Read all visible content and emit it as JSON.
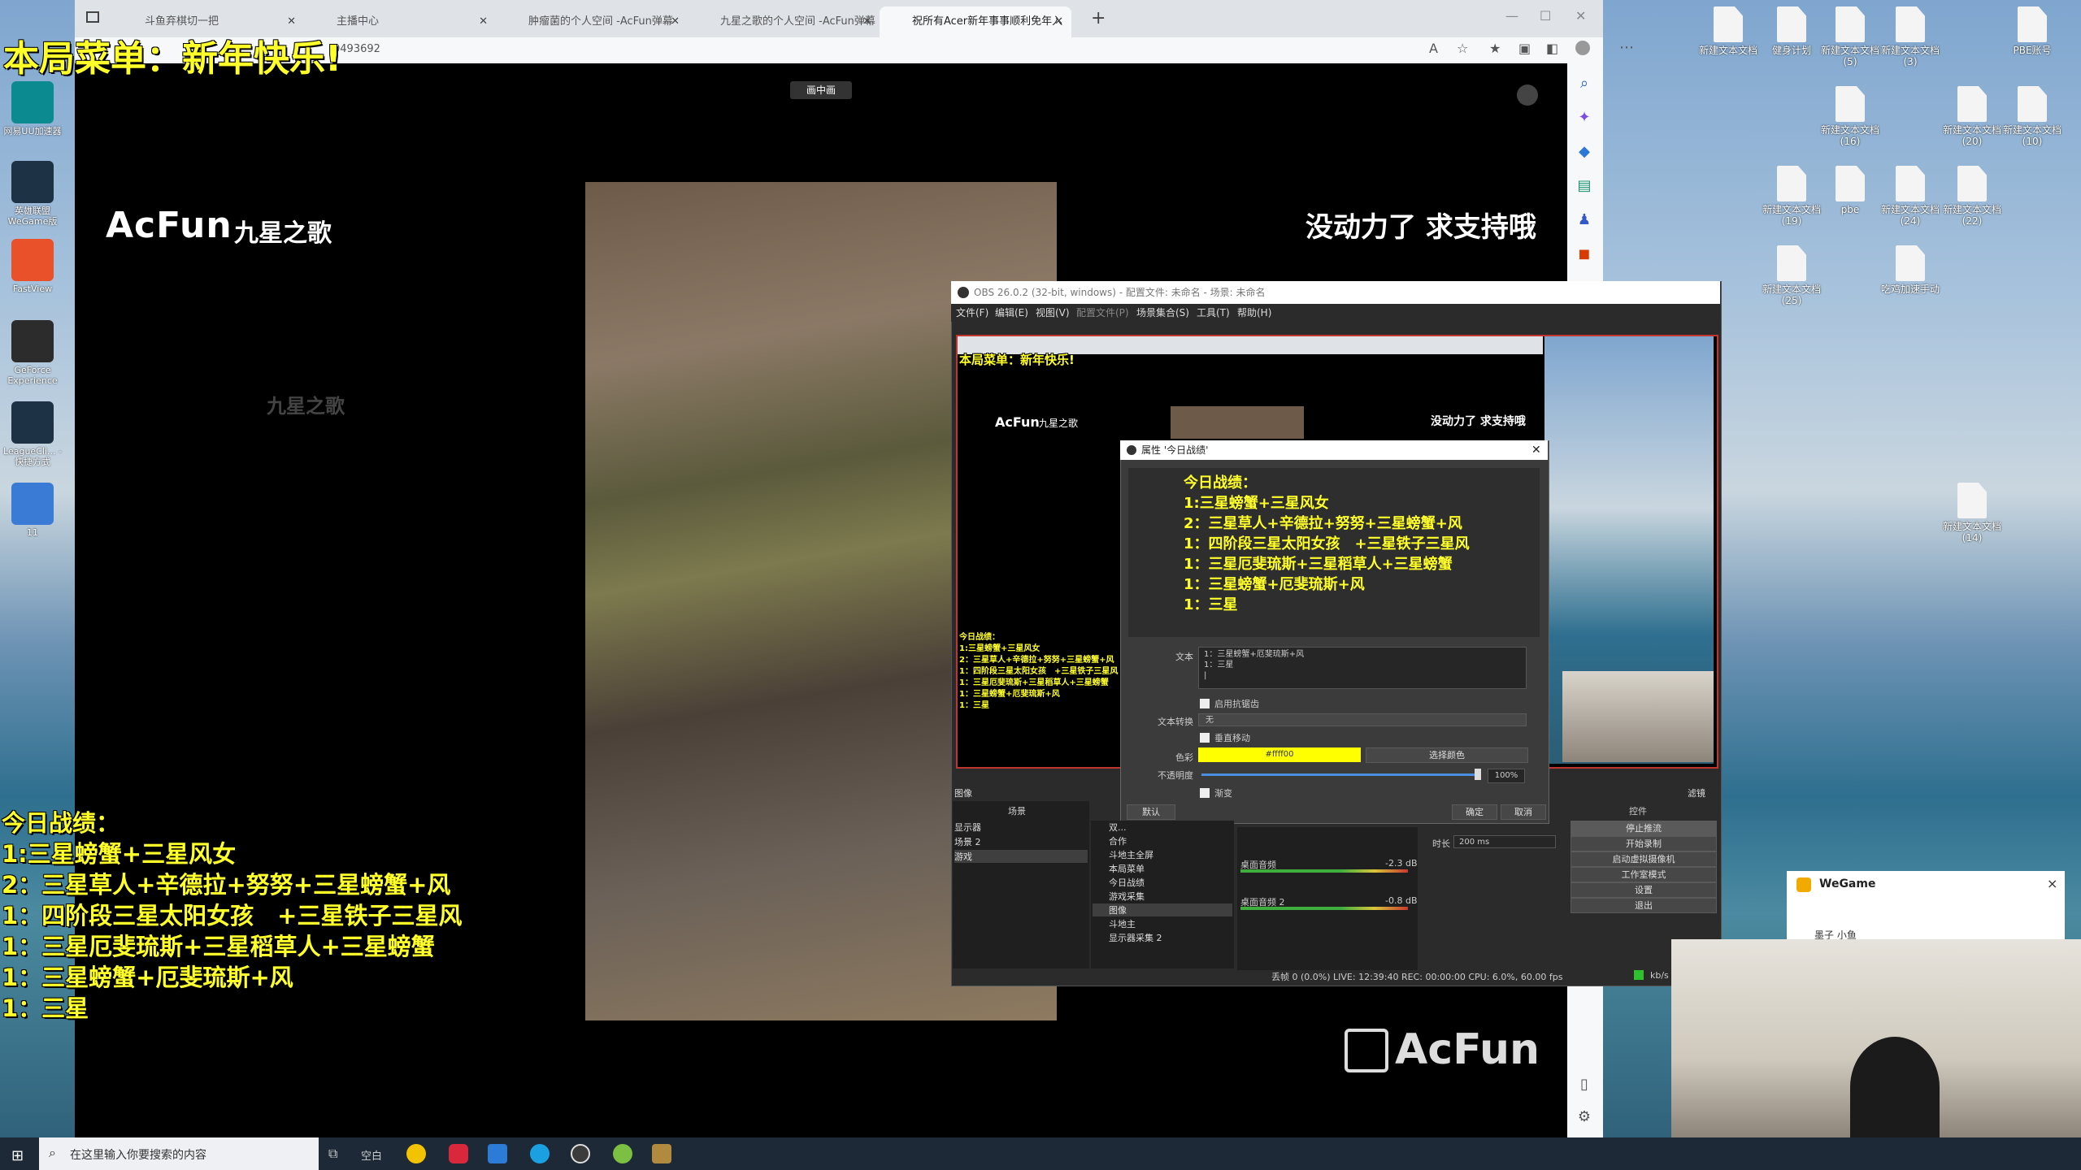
{
  "overlay": {
    "menu_title": "本局菜单：新年快乐!",
    "record_lines": [
      "今日战绩：",
      "1:三星螃蟹+三星风女",
      "2：三星草人+辛德拉+努努+三星螃蟹+风",
      "1：四阶段三星太阳女孩　+三星铁子三星风",
      "1：三星厄斐琉斯+三星稻草人+三星螃蟹",
      "1：三星螃蟹+厄斐琉斯+风",
      "1：三星"
    ],
    "support_text": "没动力了 求支持哦",
    "acfun_logo": "AcFun",
    "acfun_name": "九星之歌",
    "watermark_name": "九星之歌",
    "acfun_bottom_logo": "AcFun",
    "pip_button": "画中画"
  },
  "browser": {
    "tabs": [
      {
        "label": "斗鱼弃棋切一把"
      },
      {
        "label": "主播中心"
      },
      {
        "label": "肿瘤菌的个人空间 -AcFun弹幕"
      },
      {
        "label": "九星之歌的个人空间 -AcFun弹幕"
      },
      {
        "label": "祝所有Acer新年事事顺利免年入"
      }
    ],
    "address_fragment": "0493692",
    "new_tab_glyph": "+"
  },
  "desktop": {
    "left_icons": [
      {
        "label": "网易UU加速器",
        "icon": "uu-icon",
        "color": "#0b8a8f"
      },
      {
        "label": "英雄联盟WeGame版",
        "icon": "lol-icon",
        "color": "#1e3246"
      },
      {
        "label": "FastView",
        "icon": "fastview-icon",
        "color": "#e8512a"
      },
      {
        "label": "GeForce Experience",
        "icon": "nvidia-icon",
        "color": "#2c2c2c"
      },
      {
        "label": "LeagueCli... - 快捷方式",
        "icon": "league-client-icon",
        "color": "#1e3246"
      },
      {
        "label": "11",
        "icon": "image-file-icon",
        "color": "#3a7bd5"
      }
    ],
    "right_icons": [
      {
        "label": "新建文本文档"
      },
      {
        "label": "健身计划"
      },
      {
        "label": "新建文本文档 (5)"
      },
      {
        "label": "新建文本文档 (3)"
      },
      {
        "label": "PBE账号"
      },
      {
        "label": "新建文本文档 (16)"
      },
      {
        "label": "新建文本文档 (20)"
      },
      {
        "label": "新建文本文档 (10)"
      },
      {
        "label": "新建文本文档 (19)"
      },
      {
        "label": "pbe"
      },
      {
        "label": "新建文本文档 (24)"
      },
      {
        "label": "新建文本文档 (22)"
      },
      {
        "label": "新建文本文档 (25)"
      },
      {
        "label": "吃鸡加速手动"
      },
      {
        "label": "新建文本文档 (14)"
      }
    ]
  },
  "obs": {
    "title": "OBS 26.0.2 (32-bit, windows) - 配置文件: 未命名 - 场景: 未命名",
    "menu": [
      "文件(F)",
      "编辑(E)",
      "视图(V)",
      "配置文件(P)",
      "场景集合(S)",
      "工具(T)",
      "帮助(H)"
    ],
    "dialog": {
      "title": "属性 '今日战绩'",
      "text_label": "文本",
      "text_value_lines": [
        "1：三星螃蟹+厄斐琉斯+风",
        "1：三星",
        "|"
      ],
      "antialias_label": "启用抗锯齿",
      "transform_label": "文本转换",
      "transform_value": "无",
      "vertical_label": "垂直移动",
      "color_label": "色彩",
      "color_value": "#ffff00",
      "color_button": "选择颜色",
      "opacity_label": "不透明度",
      "opacity_value": "100%",
      "opacity_fraction": 1.0,
      "gradient_label": "渐变",
      "defaults_button": "默认",
      "ok_button": "确定",
      "cancel_button": "取消"
    },
    "image_label": "图像",
    "filters_label": "滤镜",
    "scenes_header": "场景",
    "scenes": [
      "显示器",
      "场景 2",
      "游戏"
    ],
    "sources": [
      "双...",
      "合作",
      "斗地主全屏",
      "本局菜单",
      "今日战绩",
      "游戏采集",
      "图像",
      "斗地主",
      "显示器采集 2"
    ],
    "mixer": [
      {
        "name": "桌面音频",
        "db": "-2.3 dB"
      },
      {
        "name": "桌面音频 2",
        "db": "-0.8 dB"
      }
    ],
    "transition_duration_label": "时长",
    "transition_duration": "200 ms",
    "controls_header": "控件",
    "controls": [
      "停止推流",
      "开始录制",
      "启动虚拟摄像机",
      "工作室模式",
      "设置",
      "退出"
    ],
    "status": "丢帧 0 (0.0%)   LIVE: 12:39:40   REC: 00:00:00   CPU: 6.0%, 60.00 fps",
    "status_unit": "kb/s"
  },
  "wegame": {
    "title": "WeGame",
    "close": "×",
    "user": "墨子 小鱼"
  },
  "taskbar": {
    "search_placeholder": "在这里输入你要搜索的内容",
    "widget_text": "空白"
  },
  "colors": {
    "overlay_yellow": "#ffff2a",
    "obs_red_border": "#c0352d",
    "acfun_white": "#ffffff"
  }
}
